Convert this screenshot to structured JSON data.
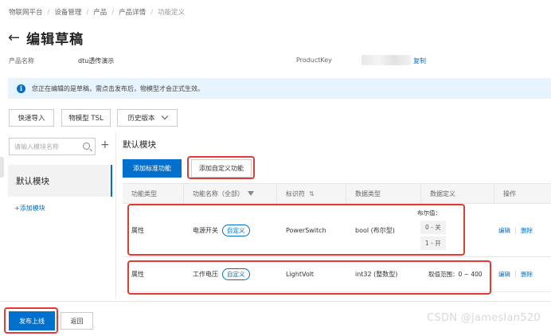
{
  "breadcrumb": [
    "物联网平台",
    "设备管理",
    "产品",
    "产品详情",
    "功能定义"
  ],
  "page": {
    "title": "编辑草稿"
  },
  "meta": {
    "product_name_label": "产品名称",
    "product_name_value": "dtu透传演示",
    "product_key_label": "ProductKey",
    "copy_label": "复制"
  },
  "notice": {
    "icon": "info-icon",
    "text": "您正在编辑的是草稿，需点击发布后，物模型才会正式生效。"
  },
  "toolbar": {
    "quick_import": "快速导入",
    "tsl": "物模型 TSL",
    "history": "历史版本"
  },
  "sidebar": {
    "search_placeholder": "请输入模块名称",
    "module": "默认模块",
    "add_module": "+添加模块"
  },
  "main": {
    "section_title": "默认模块",
    "add_standard": "添加标准功能",
    "add_custom": "添加自定义功能"
  },
  "table": {
    "headers": [
      "功能类型",
      "功能名称（全部）",
      "标识符",
      "数据类型",
      "数据定义",
      "操作"
    ],
    "rows": [
      {
        "type": "属性",
        "name": "电源开关",
        "tag": "自定义",
        "identifier": "PowerSwitch",
        "data_type": "bool (布尔型)",
        "def_label": "布尔值：",
        "def_values": [
          "0 - 关",
          "1 - 开"
        ],
        "edit": "编辑",
        "delete": "删除"
      },
      {
        "type": "属性",
        "name": "工作电压",
        "tag": "自定义",
        "identifier": "LightVolt",
        "data_type": "int32 (整数型)",
        "def_text": "取值范围：0 ~ 400",
        "edit": "编辑",
        "delete": "删除"
      }
    ]
  },
  "footer": {
    "publish": "发布上线",
    "back": "返回"
  },
  "watermark": "CSDN @jameslan520",
  "colors": {
    "accent": "#0070cc",
    "highlight": "#e53935",
    "notice_bg": "#e7f3fd"
  }
}
